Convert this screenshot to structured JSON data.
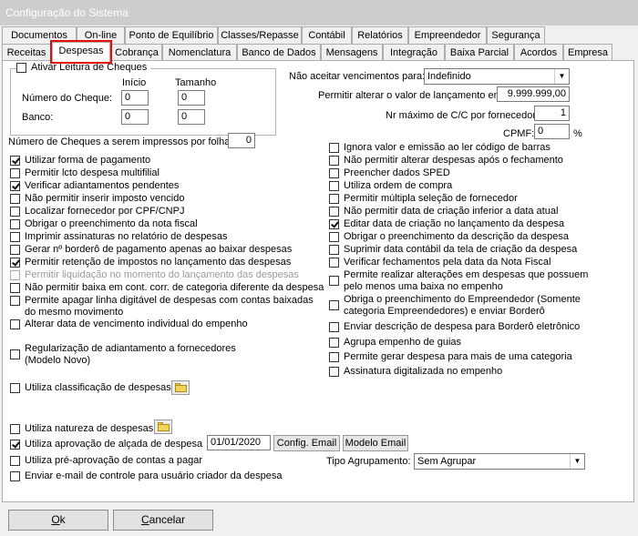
{
  "window": {
    "title": "Configuração do Sistema"
  },
  "tabs_top": [
    {
      "label": "Documentos"
    },
    {
      "label": "On-line"
    },
    {
      "label": "Ponto de Equilíbrio"
    },
    {
      "label": "Classes/Repasse"
    },
    {
      "label": "Contábil"
    },
    {
      "label": "Relatórios"
    },
    {
      "label": "Empreendedor"
    },
    {
      "label": "Segurança"
    }
  ],
  "tabs_bottom": [
    {
      "label": "Receitas"
    },
    {
      "label": "Despesas"
    },
    {
      "label": "Cobrança"
    },
    {
      "label": "Nomenclatura"
    },
    {
      "label": "Banco de Dados"
    },
    {
      "label": "Mensagens"
    },
    {
      "label": "Integração"
    },
    {
      "label": "Baixa Parcial"
    },
    {
      "label": "Acordos"
    },
    {
      "label": "Empresa"
    }
  ],
  "active_tab": "Despesas",
  "cheques": {
    "group_label": "Ativar Leitura de Cheques",
    "checked": false,
    "col_inicio": "Início",
    "col_tamanho": "Tamanho",
    "numero_label": "Número do Cheque:",
    "numero_inicio": "0",
    "numero_tamanho": "0",
    "banco_label": "Banco:",
    "banco_inicio": "0",
    "banco_tamanho": "0"
  },
  "right_top": {
    "nao_aceitar_label": "Não aceitar vencimentos para:",
    "nao_aceitar_value": "Indefinido",
    "permitir_alterar_label": "Permitir alterar o valor de lançamento em:",
    "permitir_alterar_value": "9.999.999,00",
    "nr_max_label": "Nr máximo de C/C por fornecedor:",
    "nr_max_value": "1",
    "cpmf_label": "CPMF:",
    "cpmf_value": "0",
    "cpmf_unit": "%"
  },
  "num_cheques": {
    "label": "Número de Cheques a serem impressos por folha:",
    "value": "0"
  },
  "left_options": [
    {
      "label": "Utilizar forma de pagamento",
      "checked": true
    },
    {
      "label": "Permitir lcto despesa multifilial",
      "checked": false
    },
    {
      "label": "Verificar adiantamentos pendentes",
      "checked": true
    },
    {
      "label": "Não permitir inserir imposto vencido",
      "checked": false
    },
    {
      "label": "Localizar fornecedor por CPF/CNPJ",
      "checked": false
    },
    {
      "label": "Obrigar o preenchimento da nota fiscal",
      "checked": false
    },
    {
      "label": "Imprimir assinaturas no relatório de despesas",
      "checked": false
    },
    {
      "label": "Gerar nº borderô de pagamento apenas ao baixar despesas",
      "checked": false
    },
    {
      "label": "Permitir retenção de impostos no lançamento das despesas",
      "checked": true
    },
    {
      "label": "Permitir liquidação no momento do lançamento das despesas",
      "checked": false,
      "disabled": true
    },
    {
      "label": "Não permitir baixa em cont. corr. de categoria diferente da despesa",
      "checked": false
    },
    {
      "label": "Permite apagar linha digitável de despesas com contas baixadas do mesmo movimento",
      "checked": false
    },
    {
      "label": "Alterar data de vencimento individual do empenho",
      "checked": false
    },
    {
      "label": "Regularização de adiantamento a fornecedores (Modelo Novo)",
      "checked": false
    },
    {
      "label": "Utiliza classificação de despesas",
      "checked": false
    }
  ],
  "right_options": [
    {
      "label": "Ignora valor e emissão ao ler código de barras",
      "checked": false
    },
    {
      "label": "Não permitir alterar despesas após o fechamento",
      "checked": false
    },
    {
      "label": "Preencher dados SPED",
      "checked": false
    },
    {
      "label": "Utiliza ordem de compra",
      "checked": false
    },
    {
      "label": "Permitir múltipla seleção de fornecedor",
      "checked": false
    },
    {
      "label": "Não permitir data de criação inferior a data atual",
      "checked": false
    },
    {
      "label": "Editar data de criação no lançamento da despesa",
      "checked": true
    },
    {
      "label": "Obrigar o preenchimento da descrição da despesa",
      "checked": false
    },
    {
      "label": "Suprimir data contábil da tela de criação da despesa",
      "checked": false
    },
    {
      "label": "Verificar fechamentos pela data da Nota Fiscal",
      "checked": false
    },
    {
      "label": "Permite realizar alterações em despesas que possuem pelo menos uma baixa no empenho",
      "checked": false
    },
    {
      "label": "Obriga o preenchimento do Empreendedor (Somente categoria Empreendedores) e enviar Borderô",
      "checked": false
    },
    {
      "label": "Enviar descrição de despesa para Borderô eletrônico",
      "checked": false
    },
    {
      "label": "Agrupa empenho de guias",
      "checked": false
    },
    {
      "label": "Permite gerar despesa para mais de uma categoria",
      "checked": false
    },
    {
      "label": "Assinatura digitalizada no empenho",
      "checked": false
    }
  ],
  "bottom_options": {
    "natureza": {
      "label": "Utiliza natureza de despesas",
      "checked": false
    },
    "alcada": {
      "label": "Utiliza aprovação de alçada de despesa",
      "checked": true,
      "date": "01/01/2020"
    },
    "pre_aprovacao": {
      "label": "Utiliza pré-aprovação de contas a pagar",
      "checked": false
    },
    "email_controle": {
      "label": "Enviar e-mail de controle para usuário criador da despesa",
      "checked": false
    }
  },
  "buttons": {
    "config_email": "Config. Email",
    "modelo_email": "Modelo Email",
    "ok_u": "O",
    "ok_rest": "k",
    "cancelar_u": "C",
    "cancelar_rest": "ancelar"
  },
  "agrupamento": {
    "label": "Tipo Agrupamento:",
    "value": "Sem Agrupar"
  }
}
